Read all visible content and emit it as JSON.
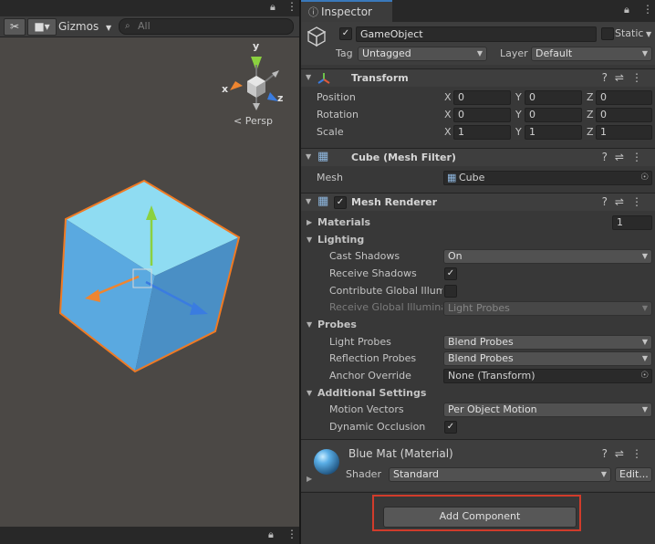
{
  "scene_toolbar": {
    "tools_icon": "tools-icon",
    "camera_icon": "camera-icon",
    "gizmos_label": "Gizmos",
    "search_placeholder": "All"
  },
  "scene_view": {
    "axis_x": "x",
    "axis_y": "y",
    "axis_z": "z",
    "projection_label": "Persp",
    "cube_color": "#5aa9e0",
    "selection_color": "#f07a23"
  },
  "inspector": {
    "tab_label": "Inspector",
    "gameobject": {
      "name": "GameObject",
      "static_label": "Static",
      "tag_label": "Tag",
      "tag_value": "Untagged",
      "layer_label": "Layer",
      "layer_value": "Default"
    },
    "transform": {
      "title": "Transform",
      "position": {
        "label": "Position",
        "x": "0",
        "y": "0",
        "z": "0"
      },
      "rotation": {
        "label": "Rotation",
        "x": "0",
        "y": "0",
        "z": "0"
      },
      "scale": {
        "label": "Scale",
        "x": "1",
        "y": "1",
        "z": "1"
      }
    },
    "mesh_filter": {
      "title": "Cube (Mesh Filter)",
      "mesh_label": "Mesh",
      "mesh_value": "Cube"
    },
    "mesh_renderer": {
      "title": "Mesh Renderer",
      "materials_label": "Materials",
      "materials_count": "1",
      "lighting_label": "Lighting",
      "cast_shadows_label": "Cast Shadows",
      "cast_shadows_value": "On",
      "receive_shadows_label": "Receive Shadows",
      "contribute_gi_label": "Contribute Global Illumin",
      "receive_gi_label": "Receive Global Illuminat",
      "receive_gi_value": "Light Probes",
      "probes_label": "Probes",
      "light_probes_label": "Light Probes",
      "light_probes_value": "Blend Probes",
      "reflection_probes_label": "Reflection Probes",
      "reflection_probes_value": "Blend Probes",
      "anchor_override_label": "Anchor Override",
      "anchor_override_value": "None (Transform)",
      "additional_label": "Additional Settings",
      "motion_vectors_label": "Motion Vectors",
      "motion_vectors_value": "Per Object Motion",
      "dynamic_occlusion_label": "Dynamic Occlusion"
    },
    "material": {
      "title": "Blue Mat (Material)",
      "shader_label": "Shader",
      "shader_value": "Standard",
      "edit_label": "Edit..."
    },
    "add_component_label": "Add Component",
    "highlight_color": "#d13c2b"
  }
}
